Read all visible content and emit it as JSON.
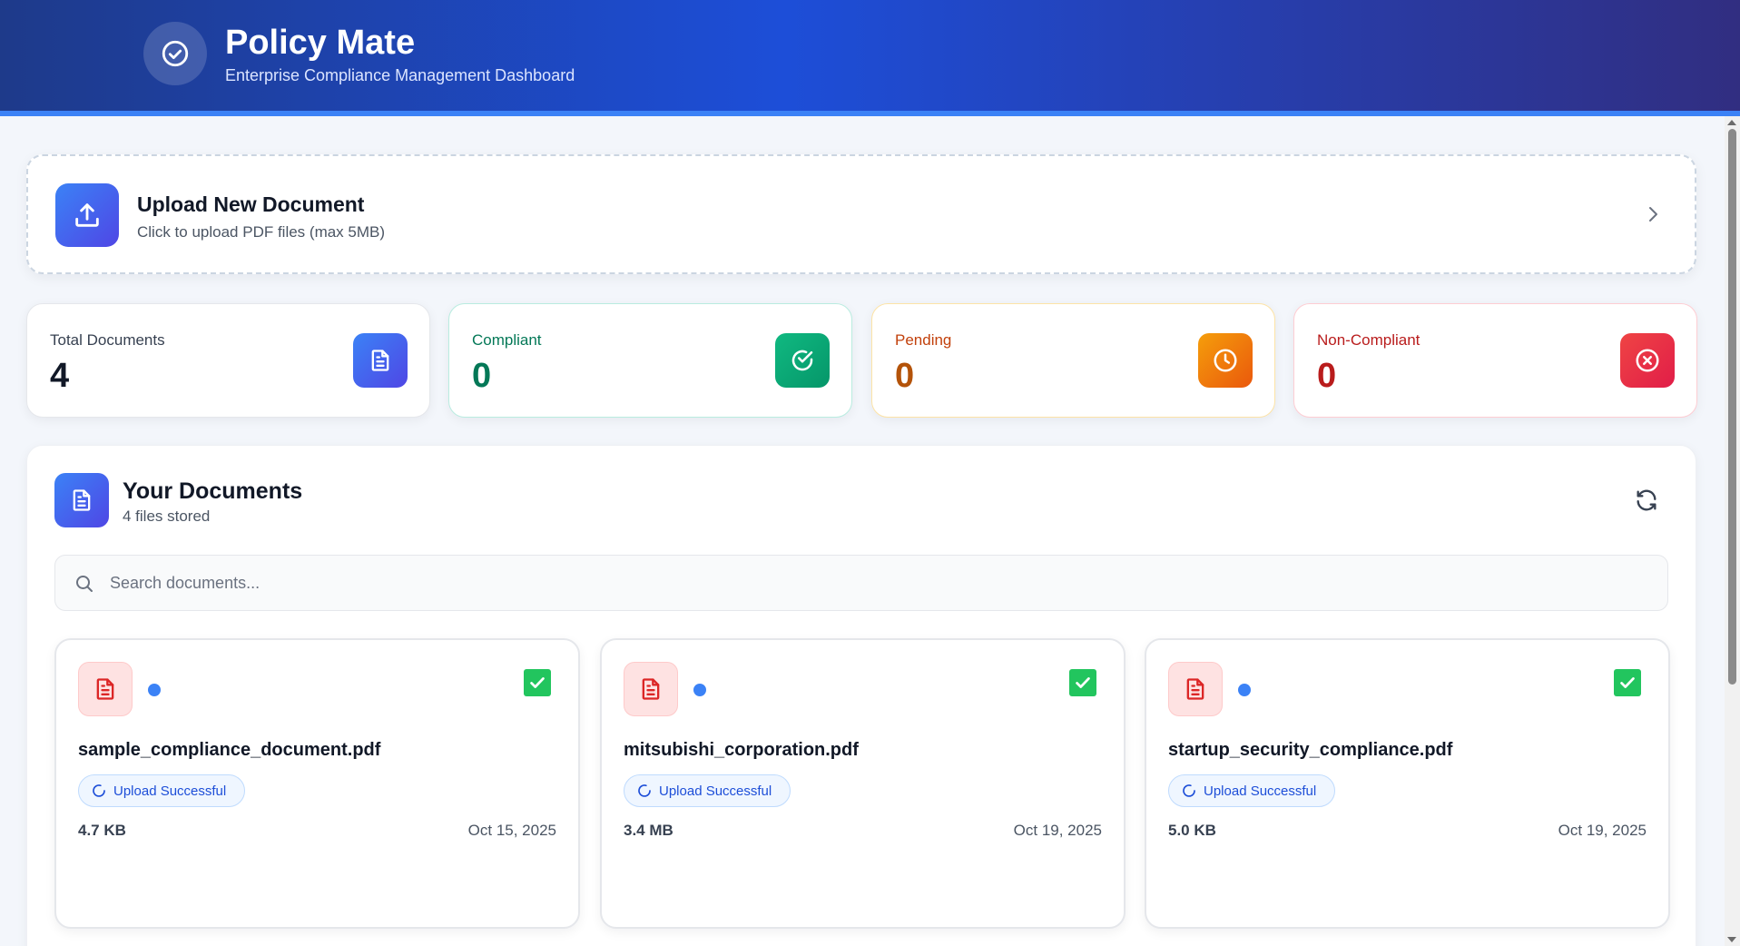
{
  "header": {
    "title": "Policy Mate",
    "subtitle": "Enterprise Compliance Management Dashboard",
    "logo_icon": "check-circle-icon"
  },
  "upload": {
    "title": "Upload New Document",
    "subtitle": "Click to upload PDF files (max 5MB)",
    "icon": "upload-icon"
  },
  "stats": {
    "total": {
      "label": "Total Documents",
      "value": "4"
    },
    "compliant": {
      "label": "Compliant",
      "value": "0"
    },
    "pending": {
      "label": "Pending",
      "value": "0"
    },
    "non_compliant": {
      "label": "Non-Compliant",
      "value": "0"
    }
  },
  "documents": {
    "title": "Your Documents",
    "subtitle": "4 files stored",
    "search": {
      "placeholder": "Search documents...",
      "value": ""
    },
    "items": [
      {
        "name": "sample_compliance_document.pdf",
        "status": "Upload Successful",
        "size": "4.7 KB",
        "date": "Oct 15, 2025",
        "selected": true
      },
      {
        "name": "mitsubishi_corporation.pdf",
        "status": "Upload Successful",
        "size": "3.4 MB",
        "date": "Oct 19, 2025",
        "selected": true
      },
      {
        "name": "startup_security_compliance.pdf",
        "status": "Upload Successful",
        "size": "5.0 KB",
        "date": "Oct 19, 2025",
        "selected": true
      }
    ]
  },
  "colors": {
    "header_start": "#1e3a8a",
    "header_end": "#312e81",
    "accent": "#3b82f6",
    "compliant": "#059669",
    "pending": "#ea580c",
    "non_compliant": "#e11d48"
  }
}
